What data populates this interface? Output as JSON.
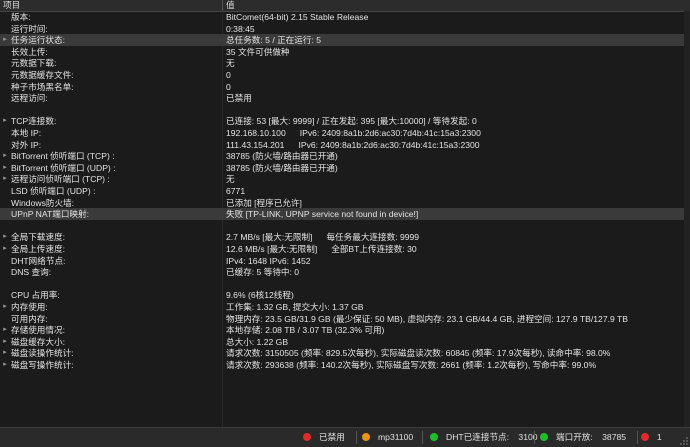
{
  "header": {
    "col_key": "项目",
    "col_value": "值"
  },
  "rows": [
    {
      "key": "版本:",
      "value": "BitComet(64-bit) 2.15 Stable Release"
    },
    {
      "key": "运行时间:",
      "value": "0:38:45"
    },
    {
      "key": "任务运行状态:",
      "value": "总任务数: 5 / 正在运行: 5",
      "expander": "▸"
    },
    {
      "key": "长效上传:",
      "value": "35 文件可供做种"
    },
    {
      "key": "元数据下载:",
      "value": "无"
    },
    {
      "key": "元数据缓存文件:",
      "value": "0"
    },
    {
      "key": "种子市场黑名单:",
      "value": "0"
    },
    {
      "key": "远程访问:",
      "value": "已禁用"
    },
    {
      "key": "",
      "value": ""
    },
    {
      "key": "TCP连接数:",
      "value": "已连接: 53 [最大: 9999] / 正在发起: 395 [最大:10000] / 等待发起: 0",
      "expander": "▸"
    },
    {
      "key": "本地 IP:",
      "value": "192.168.10.100",
      "value2": "IPv6: 2409:8a1b:2d6:ac30:7d4b:41c:15a3:2300"
    },
    {
      "key": "对外 IP:",
      "value": "111.43.154.201",
      "value2": "IPv6: 2409:8a1b:2d6:ac30:7d4b:41c:15a3:2300"
    },
    {
      "key": "BitTorrent 侦听端口 (TCP) :",
      "value": "38785 (防火墙/路由器已开通)",
      "expander": "▸"
    },
    {
      "key": "BitTorrent 侦听端口 (UDP) :",
      "value": "38785 (防火墙/路由器已开通)",
      "expander": "▸"
    },
    {
      "key": "远程访问侦听端口 (TCP) :",
      "value": "无",
      "expander": "▸"
    },
    {
      "key": "LSD 侦听端口 (UDP) :",
      "value": "6771"
    },
    {
      "key": "Windows防火墙:",
      "value": "已添加 [程序已允许]"
    },
    {
      "key": "UPnP NAT端口映射:",
      "value": "失败 [TP-LINK, UPNP service not found in device!]"
    },
    {
      "key": "",
      "value": ""
    },
    {
      "key": "全局下载速度:",
      "value": "2.7 MB/s [最大:无限制]",
      "value2": "每任务最大连接数: 9999",
      "expander": "▸"
    },
    {
      "key": "全局上传速度:",
      "value": "12.6 MB/s [最大:无限制]",
      "value2": "全部BT上传连接数: 30",
      "expander": "▸"
    },
    {
      "key": "DHT网络节点:",
      "value": "IPv4: 1648  IPv6: 1452"
    },
    {
      "key": "DNS 查询:",
      "value": "已缓存: 5   等待中: 0"
    },
    {
      "key": "",
      "value": ""
    },
    {
      "key": "CPU 占用率:",
      "value": "9.6% (6核12线程)"
    },
    {
      "key": "内存使用:",
      "value": "工作集: 1.32 GB, 提交大小: 1.37 GB",
      "expander": "▸"
    },
    {
      "key": "可用内存:",
      "value": "物理内存: 23.5 GB/31.9 GB (最少保证: 50 MB), 虚拟内存: 23.1 GB/44.4 GB, 进程空间: 127.9 TB/127.9 TB"
    },
    {
      "key": "存储使用情况:",
      "value": "本地存储: 2.08 TB / 3.07 TB (32.3% 可用)",
      "expander": "▸"
    },
    {
      "key": "磁盘缓存大小:",
      "value": "总大小: 1.22 GB",
      "expander": "▸"
    },
    {
      "key": "磁盘读操作统计:",
      "value": "请求次数: 3150505 (频率: 829.5次每秒), 实际磁盘读次数: 60845 (频率: 17.9次每秒), 读命中率: 98.0%",
      "expander": "▸"
    },
    {
      "key": "磁盘写操作统计:",
      "value": "请求次数: 293638 (频率: 140.2次每秒), 实际磁盘写次数: 2661 (频率: 1.2次每秒), 写命中率: 99.0%",
      "expander": "▸"
    }
  ],
  "highlighted_rows": [
    2,
    17
  ],
  "statusbar": {
    "remote": "已禁用",
    "user": "mp31100",
    "dht_label": "DHT已连接节点:",
    "dht_value": "3100",
    "port_label": "端口开放:",
    "port_value": "38785",
    "count": "1"
  }
}
